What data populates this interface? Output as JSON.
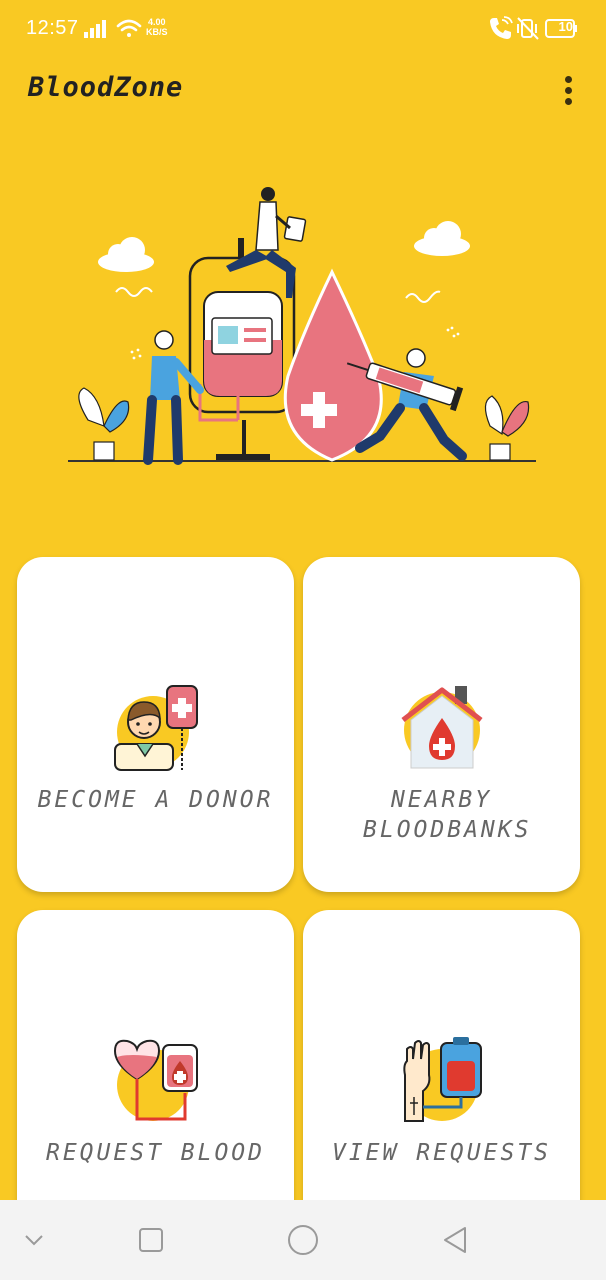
{
  "status": {
    "time": "12:57",
    "speed_value": "4.00",
    "speed_unit": "KB/S",
    "battery": "10"
  },
  "app": {
    "title": "BloodZone"
  },
  "cards": [
    {
      "label": "BECOME A DONOR",
      "icon": "donor-icon"
    },
    {
      "label": "NEARBY BLOODBANKS",
      "icon": "blood-bank-icon"
    },
    {
      "label": "REQUEST BLOOD",
      "icon": "request-blood-icon"
    },
    {
      "label": "VIEW REQUESTS",
      "icon": "view-requests-icon"
    }
  ],
  "colors": {
    "background": "#F9C923",
    "card": "#FFFFFF",
    "blood": "#E8747F",
    "text": "#666666"
  }
}
